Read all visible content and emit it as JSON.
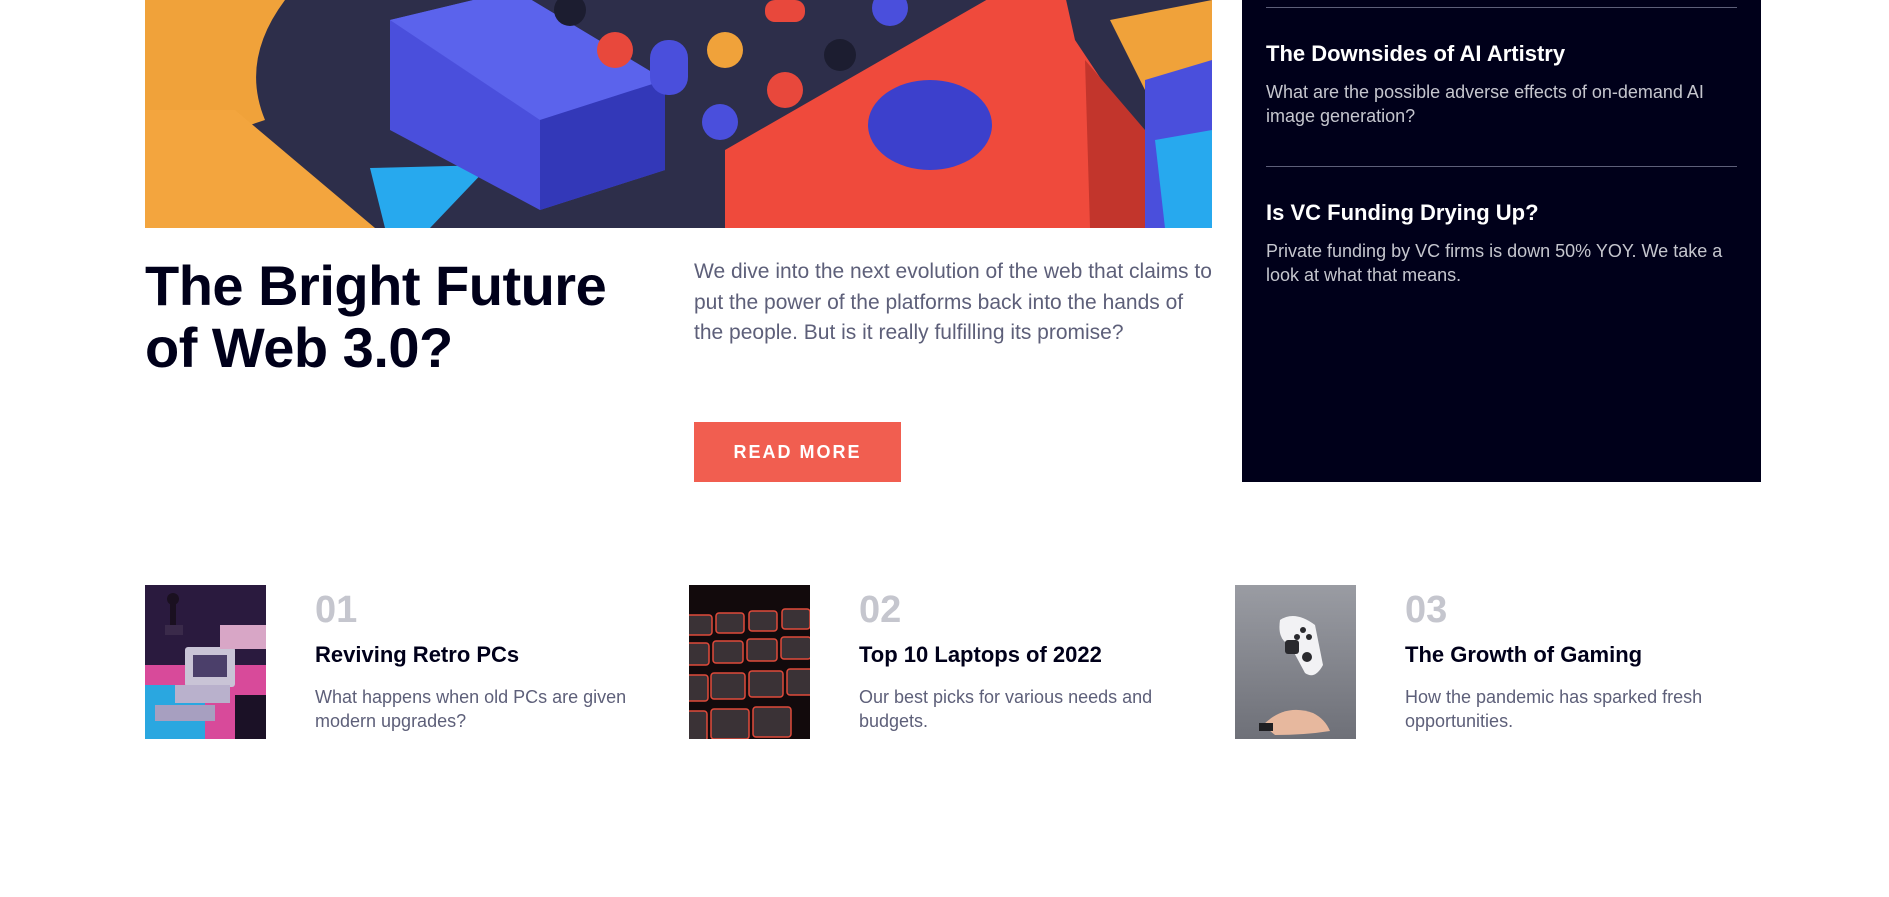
{
  "hero": {
    "title": "The Bright Future of Web 3.0?",
    "description": "We dive into the next evolution of the web that claims to put the power of the platforms back into the hands of the people. But is it really fulfilling its promise?",
    "button_label": "READ MORE",
    "image": "abstract-3d-blocks-image"
  },
  "news": {
    "items": [
      {
        "title": "The Downsides of AI Artistry",
        "text": "What are the possible adverse effects of on-demand AI image generation?"
      },
      {
        "title": "Is VC Funding Drying Up?",
        "text": "Private funding by VC firms is down 50% YOY. We take a look at what that means."
      }
    ]
  },
  "articles": [
    {
      "number": "01",
      "title": "Reviving Retro PCs",
      "description": "What happens when old PCs are given modern upgrades?",
      "image": "retro-pc-image"
    },
    {
      "number": "02",
      "title": "Top 10 Laptops of 2022",
      "description": "Our best picks for various needs and budgets.",
      "image": "keyboard-image"
    },
    {
      "number": "03",
      "title": "The Growth of Gaming",
      "description": "How the pandemic has sparked fresh opportunities.",
      "image": "gamepad-image"
    }
  ],
  "colors": {
    "dark_navy": "#00001a",
    "accent_red": "#f15e50",
    "text_gray": "#5d5f79",
    "light_gray": "#c5c6ce"
  }
}
